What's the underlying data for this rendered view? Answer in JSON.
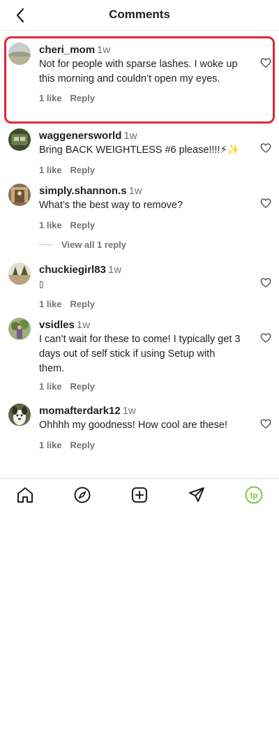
{
  "header": {
    "title": "Comments"
  },
  "comments": [
    {
      "username": "cheri_mom",
      "time": "1w",
      "text": "Not for people with sparse lashes. I woke up this morning and couldn’t open my eyes.",
      "likes": "1 like",
      "reply": "Reply"
    },
    {
      "username": "waggenersworld",
      "time": "1w",
      "text": "Bring BACK WEIGHTLESS #6 please!!!!⚡✨",
      "likes": "1 like",
      "reply": "Reply"
    },
    {
      "username": "simply.shannon.s",
      "time": "1w",
      "text": "What’s the best way to remove?",
      "likes": "1 like",
      "reply": "Reply"
    },
    {
      "username": "chuckiegirl83",
      "time": "1w",
      "text": "▯",
      "likes": "1 like",
      "reply": "Reply"
    },
    {
      "username": "vsidles",
      "time": "1w",
      "text": "I can’t wait for these to come! I typically get 3 days out of self stick if using Setup with them.",
      "likes": "1 like",
      "reply": "Reply"
    },
    {
      "username": "momafterdark12",
      "time": "1w",
      "text": "Ohhhh my goodness! How cool are these!",
      "likes": "1 like",
      "reply": "Reply"
    }
  ],
  "view_replies": "View all 1 reply",
  "tabs": [
    "home-icon",
    "explore-compass-icon",
    "create-plus-icon",
    "direct-send-icon",
    "profile-tp-icon"
  ],
  "colors": {
    "highlight": "#e0283a",
    "profile_ring": "#7ac943",
    "muted": "#737373"
  }
}
